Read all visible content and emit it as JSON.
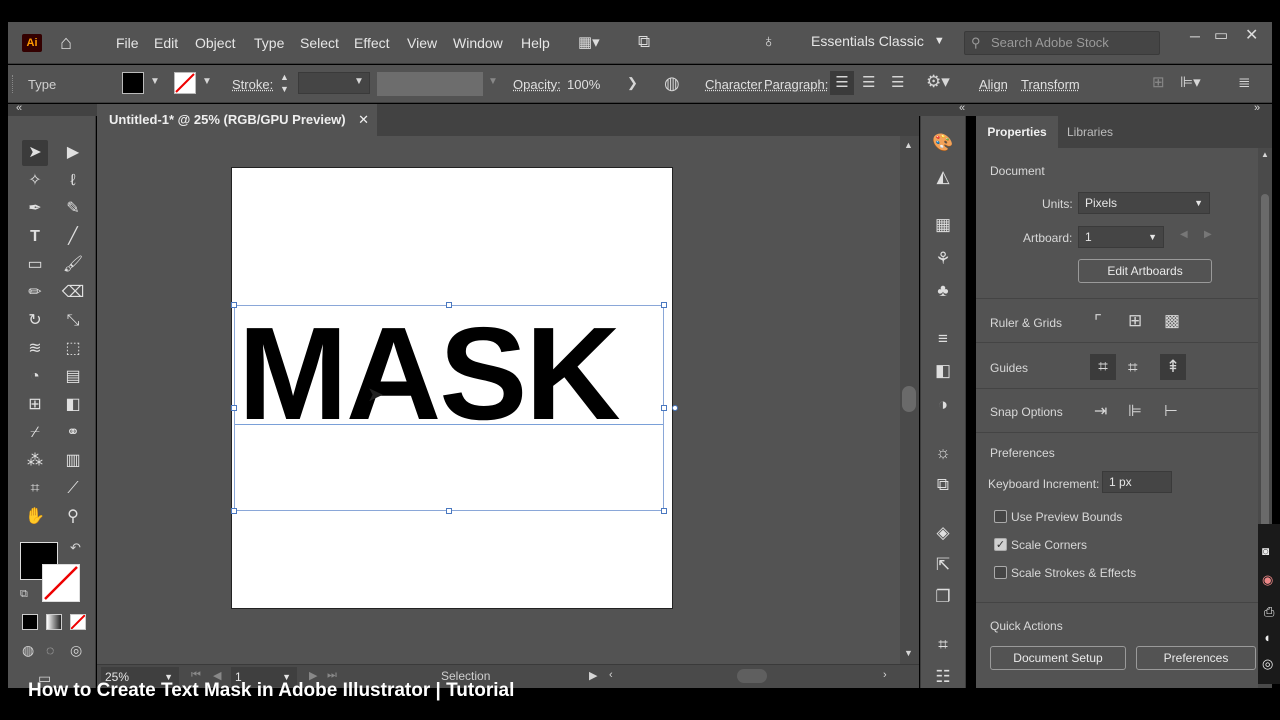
{
  "app": {
    "logo": "Ai",
    "menu": [
      "File",
      "Edit",
      "Object",
      "Type",
      "Select",
      "Effect",
      "View",
      "Window",
      "Help"
    ],
    "workspace": "Essentials Classic",
    "search_placeholder": "Search Adobe Stock"
  },
  "control_bar": {
    "tool_label": "Type",
    "stroke_label": "Stroke:",
    "opacity_label": "Opacity:",
    "opacity_value": "100%",
    "character_label": "Character",
    "paragraph_label": "Paragraph:",
    "align_label": "Align",
    "transform_label": "Transform"
  },
  "document": {
    "tab_title": "Untitled-1* @ 25% (RGB/GPU Preview)",
    "text": "MASK",
    "zoom": "25%",
    "artboard_number": "1",
    "status": "Selection"
  },
  "properties": {
    "tabs": [
      "Properties",
      "Libraries"
    ],
    "document_title": "Document",
    "units_label": "Units:",
    "units_value": "Pixels",
    "artboard_label": "Artboard:",
    "artboard_value": "1",
    "edit_artboards": "Edit Artboards",
    "ruler_grids": "Ruler & Grids",
    "guides": "Guides",
    "snap_options": "Snap Options",
    "preferences_title": "Preferences",
    "keyboard_increment_label": "Keyboard Increment:",
    "keyboard_increment_value": "1 px",
    "use_preview_bounds": "Use Preview Bounds",
    "scale_corners": "Scale Corners",
    "scale_strokes": "Scale Strokes & Effects",
    "quick_actions": "Quick Actions",
    "document_setup": "Document Setup",
    "preferences_button": "Preferences"
  },
  "caption": "How to Create Text Mask in Adobe Illustrator | Tutorial",
  "colors": {
    "ui_bg": "#535353",
    "ui_dark": "#424242",
    "accent_ai": "#ff9a00"
  }
}
